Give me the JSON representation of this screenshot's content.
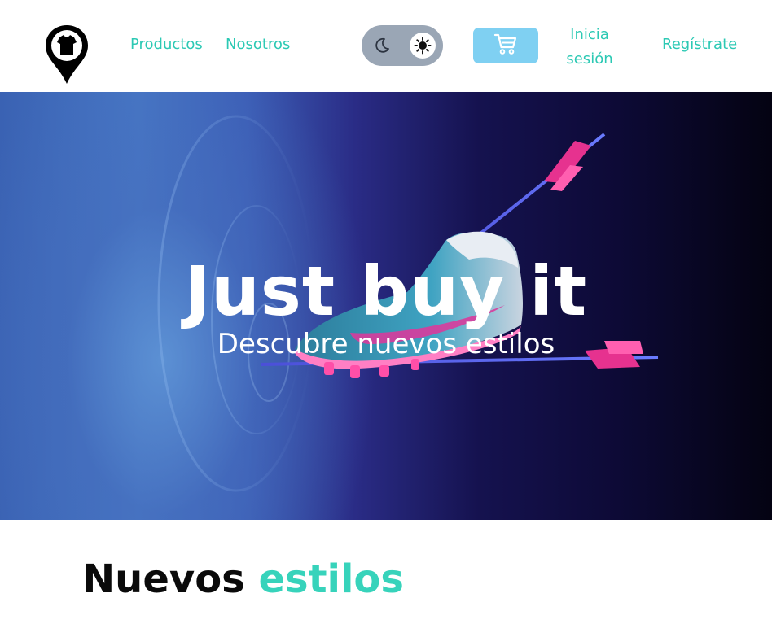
{
  "nav": {
    "logo": "shirt-location-pin-logo",
    "links": [
      "Productos",
      "Nosotros"
    ],
    "theme_toggle": {
      "dark_icon": "moon-icon",
      "light_icon": "sun-icon",
      "active": "light"
    },
    "cart_icon": "cart-icon",
    "login_line1": "Inicia",
    "login_line2": "sesión",
    "register": "Regístrate"
  },
  "hero": {
    "title": "Just buy it",
    "subtitle": "Descubre nuevos estilos",
    "image": "soccer-cleat-with-arrows"
  },
  "section": {
    "title_part1": "Nuevos",
    "title_part2": "estilos"
  },
  "colors": {
    "accent": "#2cc9b4",
    "accent_bright": "#37d3bb",
    "cart_bg": "#7fd0f2",
    "toggle_bg": "#9aa6b5",
    "hero_dark": "#0d0a36"
  }
}
